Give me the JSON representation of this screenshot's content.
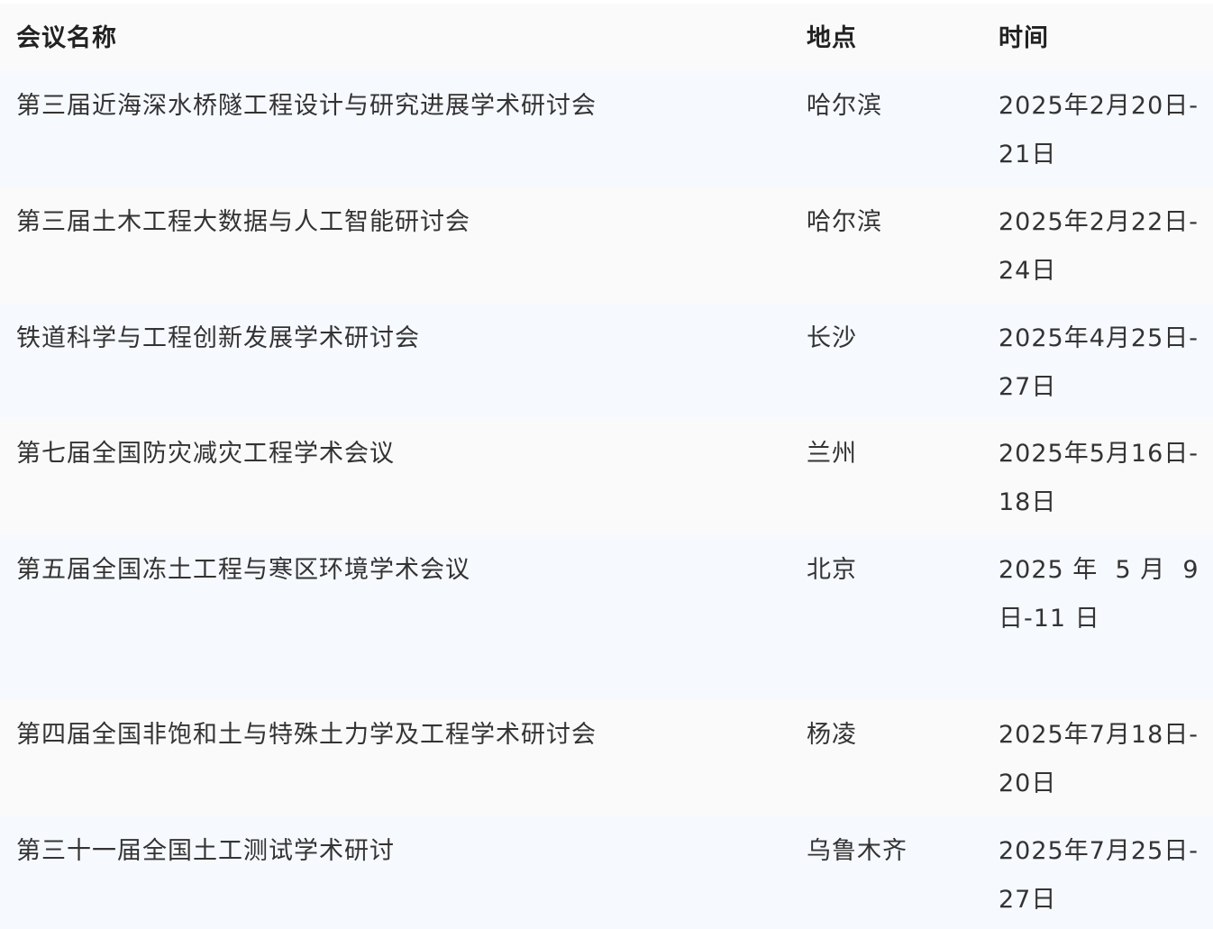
{
  "table": {
    "headers": [
      "会议名称",
      "地点",
      "时间"
    ],
    "rows": [
      {
        "name": "第三届近海深水桥隧工程设计与研究进展学术研讨会",
        "place": "哈尔滨",
        "time": "2025年2月20日-21日"
      },
      {
        "name": "第三届土木工程大数据与人工智能研讨会",
        "place": "哈尔滨",
        "time": "2025年2月22日-24日"
      },
      {
        "name": "铁道科学与工程创新发展学术研讨会",
        "place": "长沙",
        "time": "2025年4月25日-27日"
      },
      {
        "name": "第七届全国防灾减灾工程学术会议",
        "place": "兰州",
        "time": "2025年5月16日-18日"
      },
      {
        "name": "第五届全国冻土工程与寒区环境学术会议",
        "place": "北京",
        "time_line1": "2025 年  5 月  9",
        "time_line2": "日-11 日"
      },
      {
        "name": "第四届全国非饱和土与特殊土力学及工程学术研讨会",
        "place": "杨凌",
        "time": "2025年7月18日-20日"
      },
      {
        "name": "第三十一届全国土工测试学术研讨",
        "place": "乌鲁木齐",
        "time": "2025年7月25日-27日"
      }
    ]
  },
  "colors": {
    "header_bg": "#fafafa",
    "row_odd_bg": "#f6f9fd",
    "row_even_bg": "#fafafa",
    "text": "#333333"
  }
}
